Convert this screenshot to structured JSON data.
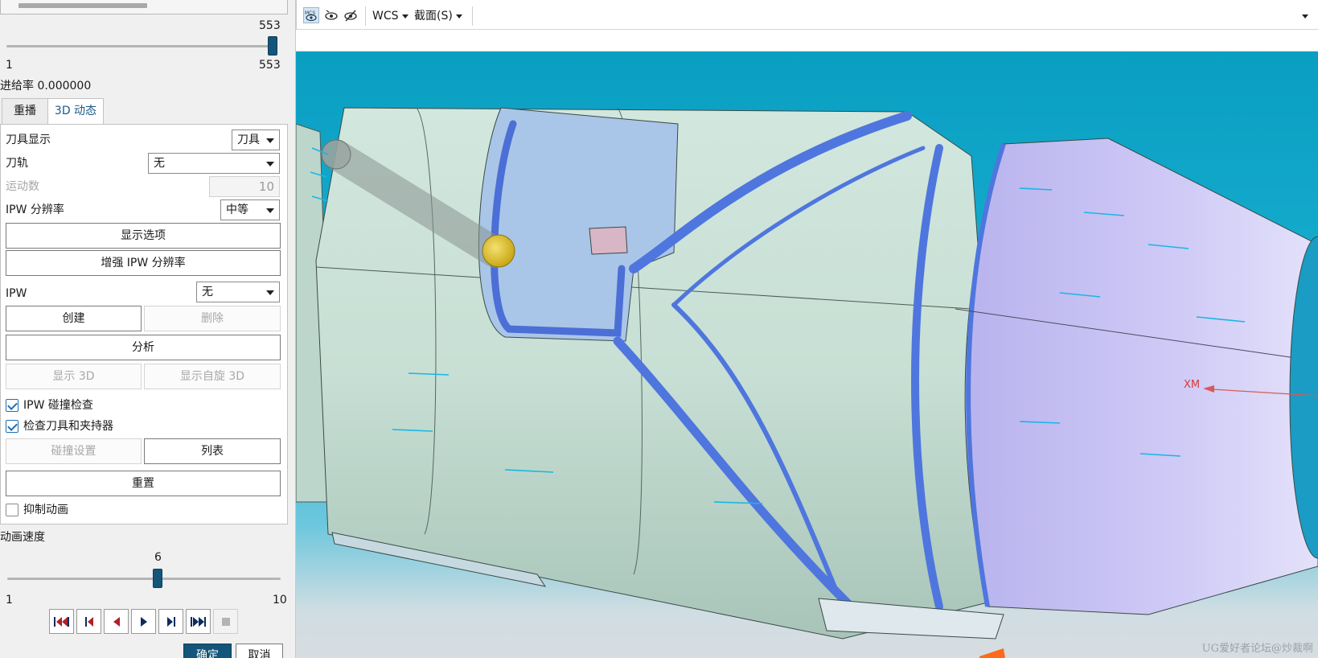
{
  "panel": {
    "top_scroll": "",
    "slider_main": {
      "value_label": "553",
      "min_label": "1",
      "max_label": "553",
      "value_fraction": 1.0
    },
    "feed_rate": "进给率 0.000000",
    "tabs": [
      {
        "label": "重播",
        "active": false
      },
      {
        "label": "3D 动态",
        "active": true
      }
    ],
    "tool_display": {
      "label": "刀具显示",
      "value": "刀具"
    },
    "tool_path": {
      "label": "刀轨",
      "value": "无"
    },
    "motion_count": {
      "label": "运动数",
      "value": "10"
    },
    "ipw_resolution": {
      "label": "IPW 分辨率",
      "value": "中等"
    },
    "display_options_button": "显示选项",
    "enhance_ipw_button": "增强 IPW 分辨率",
    "ipw": {
      "label": "IPW",
      "value": "无"
    },
    "create_button": "创建",
    "delete_button": "删除",
    "analyze_button": "分析",
    "show_3d_button": "显示 3D",
    "show_rotated_3d_button": "显示自旋 3D",
    "ipw_collision_check": {
      "label": "IPW 碰撞检查",
      "checked": true
    },
    "check_tool_holder": {
      "label": "检查刀具和夹持器",
      "checked": true
    },
    "collision_settings_button": "碰撞设置",
    "list_button": "列表",
    "reset_button": "重置",
    "suppress_animation": {
      "label": "抑制动画",
      "checked": false
    },
    "animation_speed": {
      "label": "动画速度",
      "value_label": "6",
      "min_label": "1",
      "max_label": "10",
      "value_fraction": 0.5556
    },
    "playback_buttons": [
      "go-to-start",
      "step-back",
      "play-reverse",
      "play-forward",
      "step-forward",
      "go-to-end",
      "stop"
    ],
    "ok_button": "确定",
    "cancel_button": "取消"
  },
  "toolbar": {
    "wcs_label": "WCS",
    "section_label": "截面(S)",
    "icons": [
      "mcs-eye-icon",
      "eye-icon",
      "eye-slash-icon"
    ]
  },
  "viewport": {
    "axis_label": "XM",
    "watermark": "UG爱好者论坛@炒裁啊"
  },
  "colors": {
    "accent": "#14557a",
    "viewport_bg_top": "#0a9fc2",
    "part_green": "#d9ece3",
    "part_purple": "#c4c0f0",
    "groove_blue": "#5b7ee0",
    "tool_yellow": "#e8c91a"
  }
}
